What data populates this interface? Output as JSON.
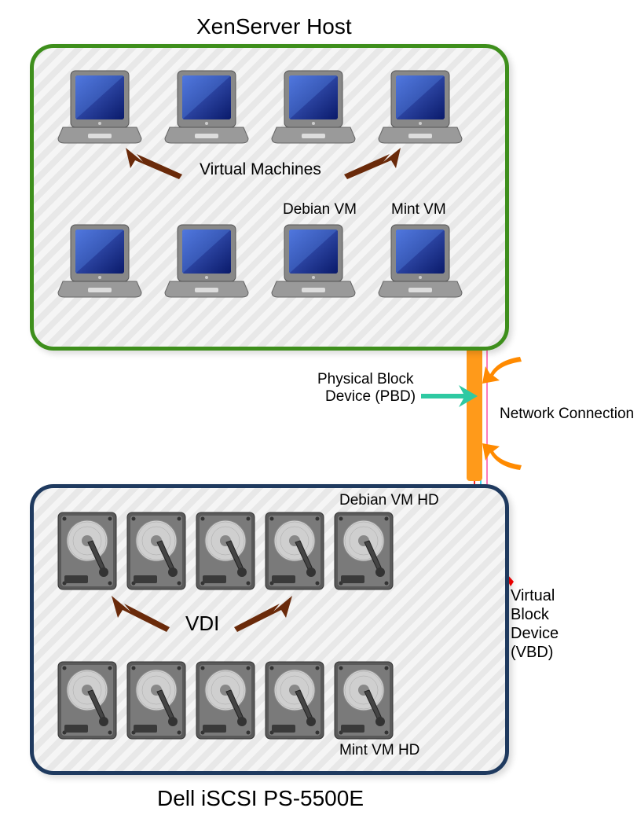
{
  "titles": {
    "host": "XenServer Host",
    "storage": "Dell iSCSI PS-5500E"
  },
  "labels": {
    "vm": "Virtual Machines",
    "debian_vm": "Debian VM",
    "mint_vm": "Mint VM",
    "pbd_line1": "Physical Block",
    "pbd_line2": "Device (PBD)",
    "network": "Network Connection",
    "debian_hd": "Debian VM HD",
    "mint_hd": "Mint VM HD",
    "vdi": "VDI",
    "vbd_l1": "Virtual",
    "vbd_l2": "Block",
    "vbd_l3": "Device",
    "vbd_l4": "(VBD)"
  }
}
